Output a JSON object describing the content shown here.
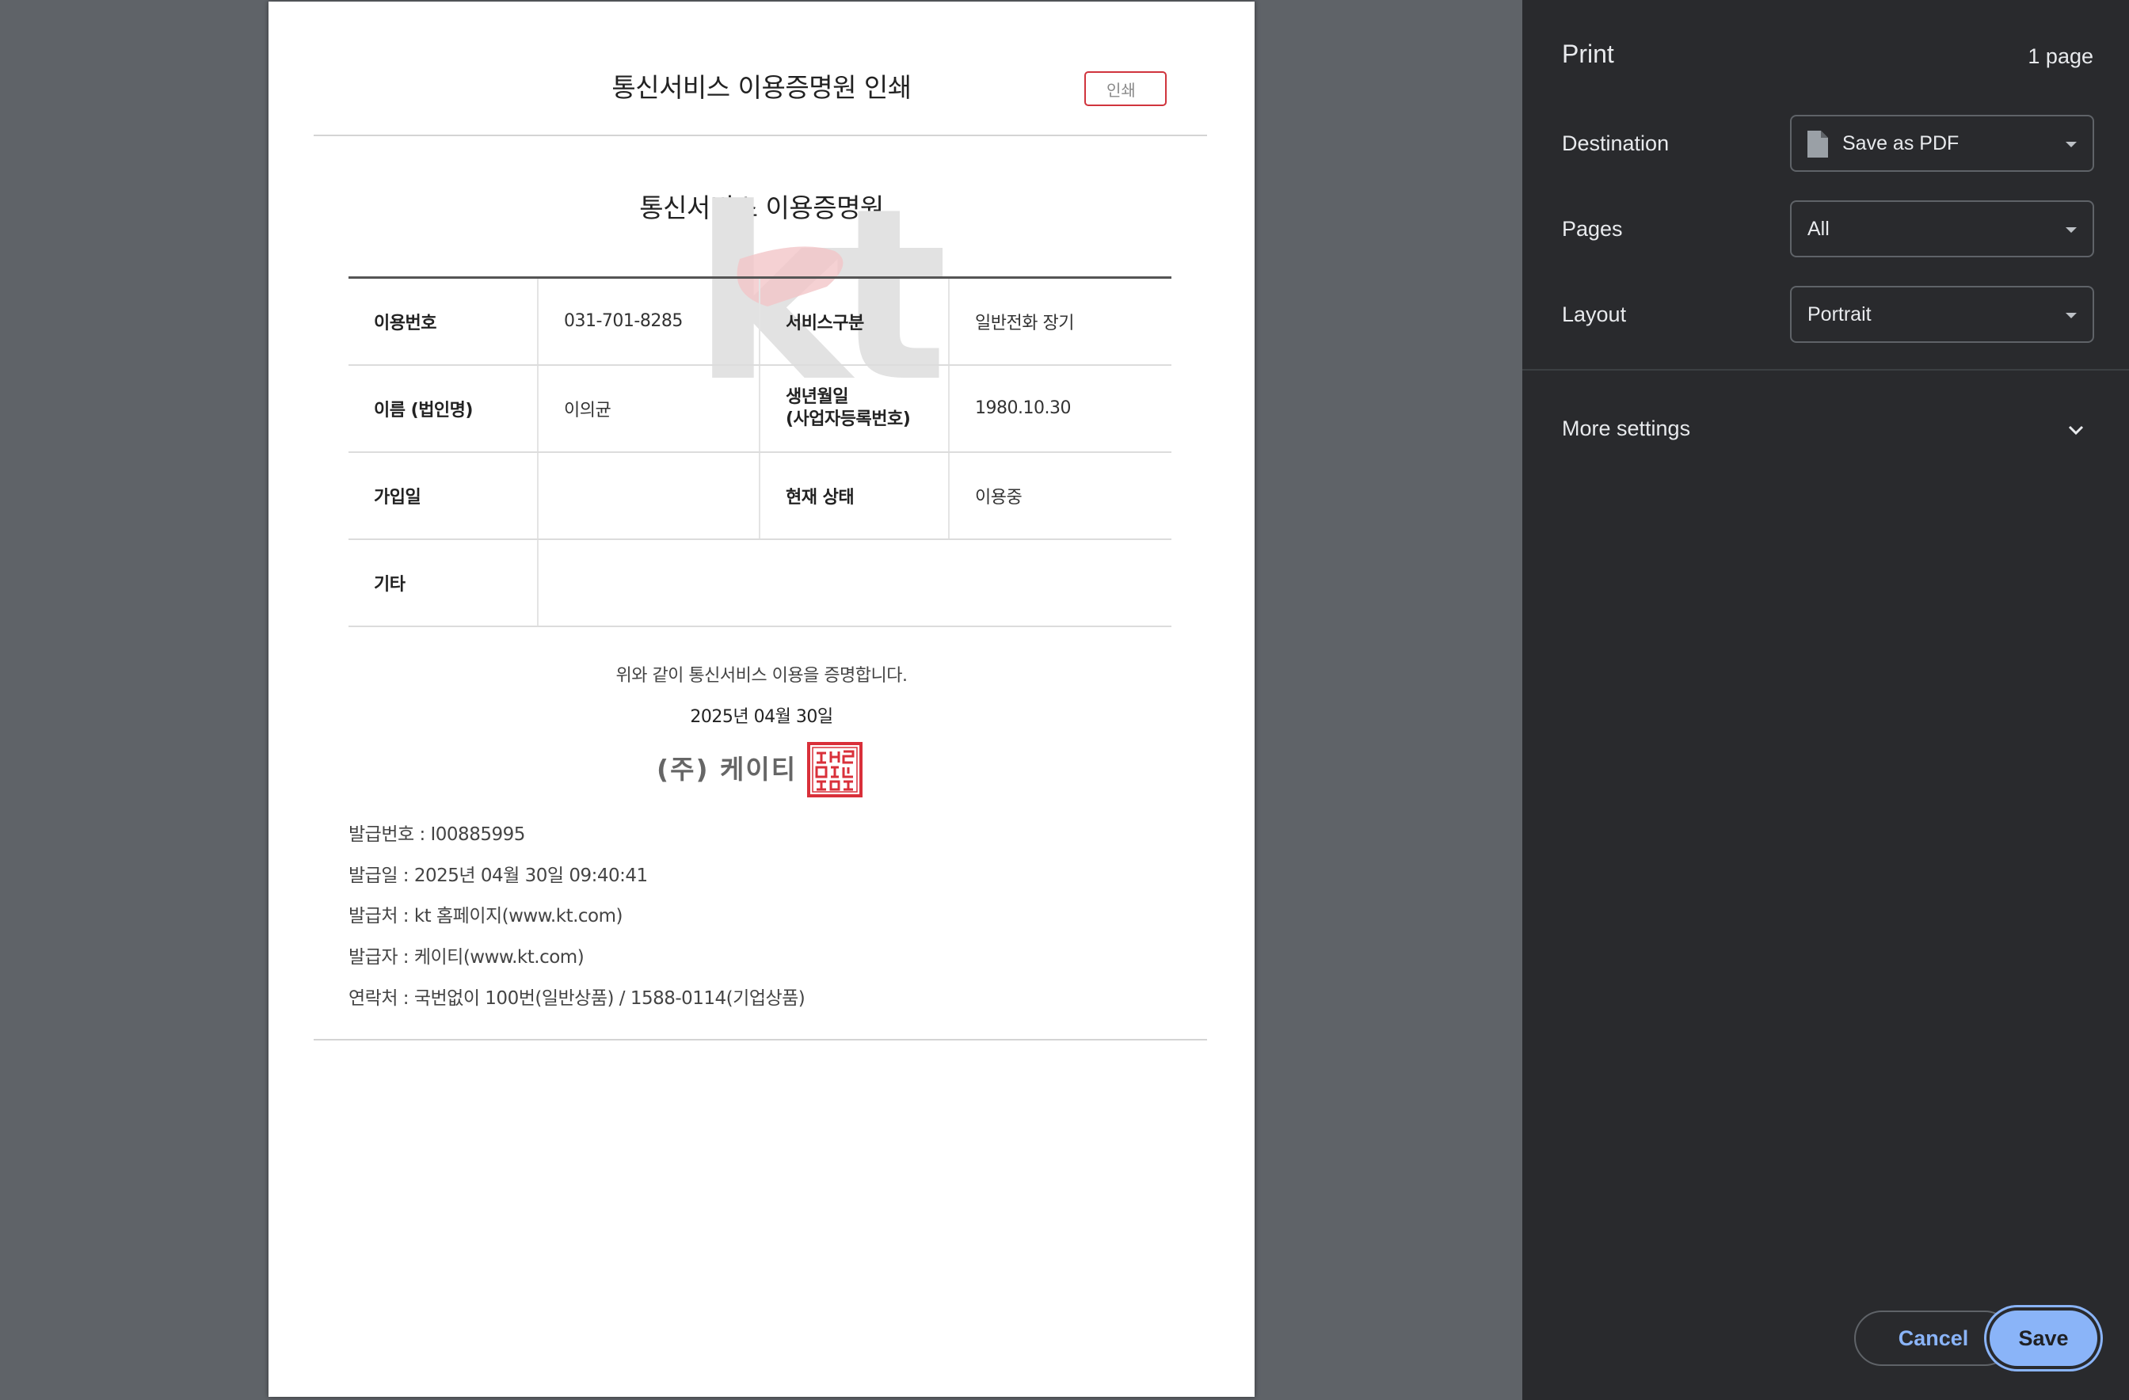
{
  "document": {
    "header_title": "통신서비스 이용증명원 인쇄",
    "print_button_label": "인쇄",
    "title": "통신서비스 이용증명원",
    "table": [
      {
        "label1": "이용번호",
        "value1": "031-701-8285",
        "label2": "서비스구분",
        "value2": "일반전화 장기"
      },
      {
        "label1": "이름 (법인명)",
        "value1": "이의균",
        "label2": "생년월일\n(사업자등록번호)",
        "value2": "1980.10.30"
      },
      {
        "label1": "가입일",
        "value1": "",
        "label2": "현재 상태",
        "value2": "이용중"
      },
      {
        "label1": "기타",
        "value1": ""
      }
    ],
    "certify_text": "위와 같이 통신서비스 이용을 증명합니다.",
    "date": "2025년 04월 30일",
    "company": "(주) 케이티",
    "watermark_text": "kt",
    "issue_info": [
      "발급번호 : I00885995",
      "발급일 : 2025년 04월 30일 09:40:41",
      "발급처 : kt 홈페이지(www.kt.com)",
      "발급자 : 케이티(www.kt.com)",
      "연락처 : 국번없이 100번(일반상품) / 1588-0114(기업상품)"
    ]
  },
  "print_panel": {
    "title": "Print",
    "page_count": "1 page",
    "destination_label": "Destination",
    "destination_value": "Save as PDF",
    "pages_label": "Pages",
    "pages_value": "All",
    "layout_label": "Layout",
    "layout_value": "Portrait",
    "more_settings_label": "More settings",
    "cancel_label": "Cancel",
    "save_label": "Save"
  },
  "icons": {
    "destination": "pdf-file-icon",
    "more_settings": "chevron-down-icon",
    "select_caret": "caret-down-icon"
  },
  "colors": {
    "panel_bg": "#292a2d",
    "preview_bg": "#5f6368",
    "accent": "#8ab4f8",
    "kt_red": "#d0343d"
  }
}
